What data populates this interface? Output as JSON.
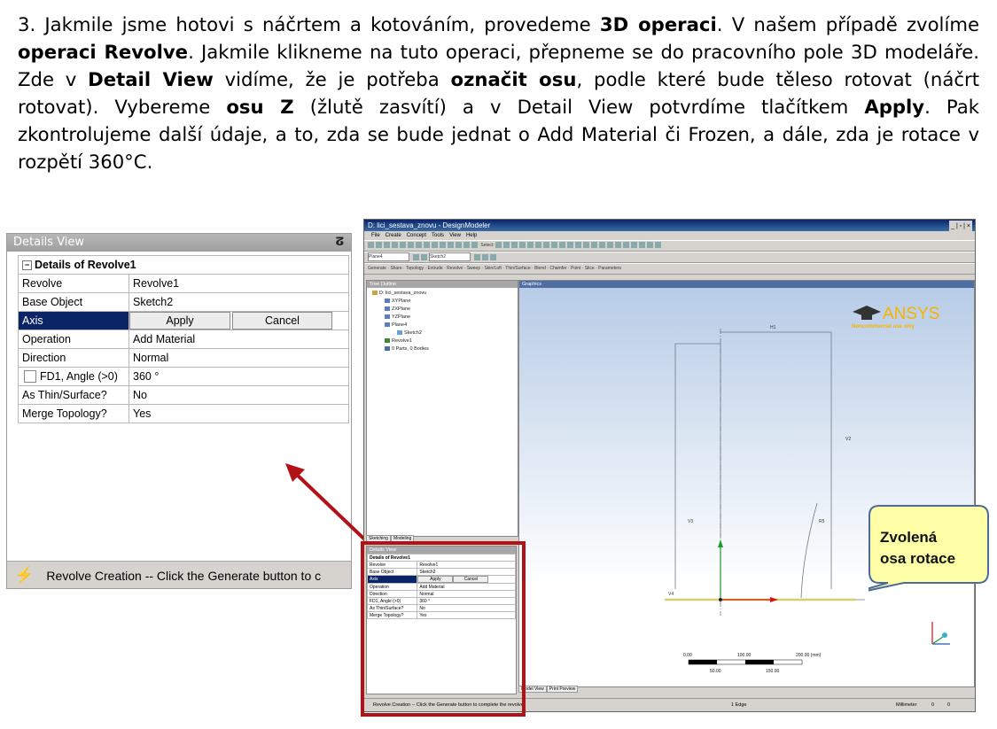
{
  "paragraph": {
    "t1": "3. Jakmile jsme hotovi s náčrtem a kotováním, provedeme ",
    "b1": "3D operaci",
    "t2": ". V našem případě zvolíme ",
    "b2": "operaci Revolve",
    "t3": ". Jakmile klikneme na tuto operaci, přepneme se do pracovního pole 3D modeláře. Zde v ",
    "b3": "Detail View",
    "t4": " vidíme, že je potřeba ",
    "b4": "označit osu",
    "t5": ", podle které bude těleso rotovat (náčrt rotovat). Vybereme ",
    "b5": "osu Z",
    "t6": " (žlutě zasvítí) a v Detail View potvrdíme tlačítkem ",
    "b6": "Apply",
    "t7": ". Pak zkontrolujeme další údaje, a to, zda se bude jednat o Add Material či Frozen, a dále, zda je rotace v rozpětí 360°C."
  },
  "details_view": {
    "title": "Details View",
    "pin": "ⵒ",
    "header": "Details of Revolve1",
    "rows": [
      {
        "label": "Revolve",
        "value": "Revolve1"
      },
      {
        "label": "Base Object",
        "value": "Sketch2"
      },
      {
        "label": "Axis",
        "apply": "Apply",
        "cancel": "Cancel"
      },
      {
        "label": "Operation",
        "value": "Add Material"
      },
      {
        "label": "Direction",
        "value": "Normal"
      },
      {
        "label": "FD1,  Angle (>0)",
        "value": "360 °"
      },
      {
        "label": "As Thin/Surface?",
        "value": "No"
      },
      {
        "label": "Merge Topology?",
        "value": "Yes"
      }
    ],
    "status": "Revolve Creation -- Click the Generate button to c"
  },
  "designmodeler": {
    "title": "D: lici_sestava_znovu - DesignModeler",
    "window_controls": "_ | ▫ | ×",
    "menu": [
      "File",
      "Create",
      "Concept",
      "Tools",
      "View",
      "Help"
    ],
    "toolbar1": "Select:",
    "toolbar2_plane": "Plane4",
    "toolbar2_sketch": "Sketch2",
    "toolbar3": [
      "Generate",
      "Share",
      "Topology",
      "Extrude",
      "Revolve",
      "Sweep",
      "Skin/Loft",
      "Thin/Surface",
      "Blend",
      "Chamfer",
      "Point",
      "Slice",
      "Parameters"
    ],
    "tree_title": "Tree Outline",
    "tree": [
      "D: lici_sestava_znovu",
      "XYPlane",
      "ZXPlane",
      "YZPlane",
      "Plane4",
      "Sketch2",
      "Revolve1",
      "0 Parts, 0 Bodies"
    ],
    "tabs_left": [
      "Sketching",
      "Modeling"
    ],
    "details_title": "Details View",
    "details_header": "Details of Revolve1",
    "details_rows": [
      {
        "label": "Revolve",
        "value": "Revolve1"
      },
      {
        "label": "Base Object",
        "value": "Sketch2"
      },
      {
        "label": "Axis",
        "apply": "Apply",
        "cancel": "Cancel"
      },
      {
        "label": "Operation",
        "value": "Add Material"
      },
      {
        "label": "Direction",
        "value": "Normal"
      },
      {
        "label": "FD1, Angle (>0)",
        "value": "360 °"
      },
      {
        "label": "As Thin/Surface?",
        "value": "No"
      },
      {
        "label": "Merge Topology?",
        "value": "Yes"
      }
    ],
    "graphics_title": "Graphics",
    "ansys_logo": "ANSYS",
    "ansys_sub": "Noncommercial use only",
    "dims": {
      "h1": "H1",
      "v2": "V2",
      "v3": "V3",
      "v4": "V4",
      "r": "R5"
    },
    "scale": {
      "s0": "0.00",
      "s100": "100.00",
      "s200": "200.00 (mm)",
      "s50": "50.00",
      "s150": "150.00"
    },
    "tabs_bottom": [
      "Model View",
      "Print Preview"
    ],
    "status_left": "Revolve Creation -- Click the Generate button to complete the revolve",
    "status_mid": "1 Edge",
    "status_units": "Millimeter",
    "status_v1": "0",
    "status_v2": "0"
  },
  "callout": {
    "line1": "Zvolená",
    "line2": "osa rotace"
  },
  "colors": {
    "selection": "#0a2466",
    "highlight_box": "#b21216",
    "callout_fill": "#ffffa8",
    "callout_border": "#4d6b9a"
  }
}
